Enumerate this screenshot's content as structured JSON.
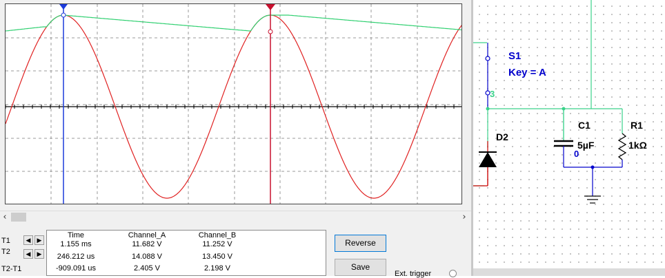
{
  "scope": {
    "cursors": {
      "t1_label": "T1",
      "t2_label": "T2",
      "t2t1_label": "T2-T1"
    },
    "readout": {
      "headers": [
        "Time",
        "Channel_A",
        "Channel_B"
      ],
      "rows": [
        [
          "1.155 ms",
          "11.682 V",
          "11.252 V"
        ],
        [
          "246.212 us",
          "14.088 V",
          "13.450 V"
        ],
        [
          "-909.091 us",
          "2.405 V",
          "2.198 V"
        ]
      ]
    },
    "buttons": {
      "reverse": "Reverse",
      "save": "Save"
    },
    "ext_trigger_label": "Ext. trigger",
    "trace_colors": {
      "channel_a": "#e02020",
      "channel_b": "#30d070",
      "cursor1": "#1c3bdc",
      "cursor2": "#c8102e"
    },
    "t1_arrow_icon": "arrow-left-right-icon",
    "t2_arrow_icon": "arrow-left-right-icon"
  },
  "schematic": {
    "switch": {
      "name": "S1",
      "key": "Key = A",
      "node": "3"
    },
    "diode": {
      "name": "D2"
    },
    "capacitor": {
      "name": "C1",
      "value": "5µF",
      "node": "0"
    },
    "resistor": {
      "name": "R1",
      "value": "1kΩ"
    },
    "wire_color": "#3ad28a",
    "label_color": "#0000cc"
  }
}
